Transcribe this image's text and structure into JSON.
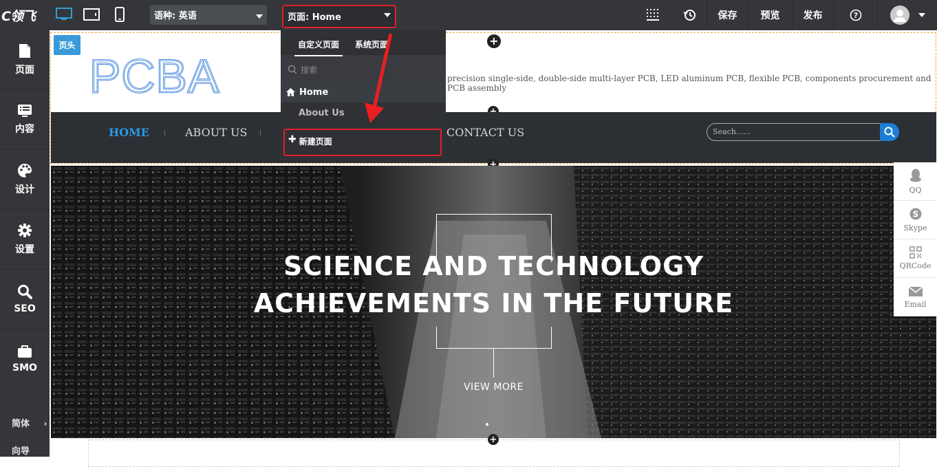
{
  "topbar": {
    "logo": "C领飞",
    "language_select": "语种: 英语",
    "page_select": "页面: Home",
    "save": "保存",
    "preview": "预览",
    "publish": "发布"
  },
  "sidebar": {
    "items": [
      {
        "label": "页面",
        "icon": "page-icon"
      },
      {
        "label": "内容",
        "icon": "content-icon"
      },
      {
        "label": "设计",
        "icon": "palette-icon"
      },
      {
        "label": "设置",
        "icon": "gear-icon"
      },
      {
        "label": "SEO",
        "icon": "search-icon"
      },
      {
        "label": "SMO",
        "icon": "briefcase-icon"
      }
    ],
    "footer": [
      {
        "label": "简体"
      },
      {
        "label": "向导"
      }
    ]
  },
  "page_dropdown": {
    "tabs": [
      "自定义页面",
      "系统页面"
    ],
    "search_placeholder": "搜索",
    "pages": [
      "Home",
      "About Us"
    ],
    "new_page": "新建页面"
  },
  "site": {
    "header_tag": "页头",
    "logo_text": "PCBA",
    "description": "precision single-side, double-side multi-layer PCB, LED aluminum PCB, flexible PCB, components procurement and PCB assembly",
    "nav": [
      "HOME",
      "ABOUT US",
      "CONTACT US"
    ],
    "search_placeholder": "Seach......",
    "accent": "#1e7ed6",
    "banner": {
      "title_line1": "SCIENCE AND TECHNOLOGY",
      "title_line2": "ACHIEVEMENTS IN THE FUTURE",
      "cta": "VIEW MORE"
    },
    "float_bar": [
      {
        "label": "QQ",
        "icon": "qq-icon"
      },
      {
        "label": "Skype",
        "icon": "skype-icon"
      },
      {
        "label": "QRCode",
        "icon": "qrcode-icon"
      },
      {
        "label": "Email",
        "icon": "email-icon"
      }
    ]
  }
}
